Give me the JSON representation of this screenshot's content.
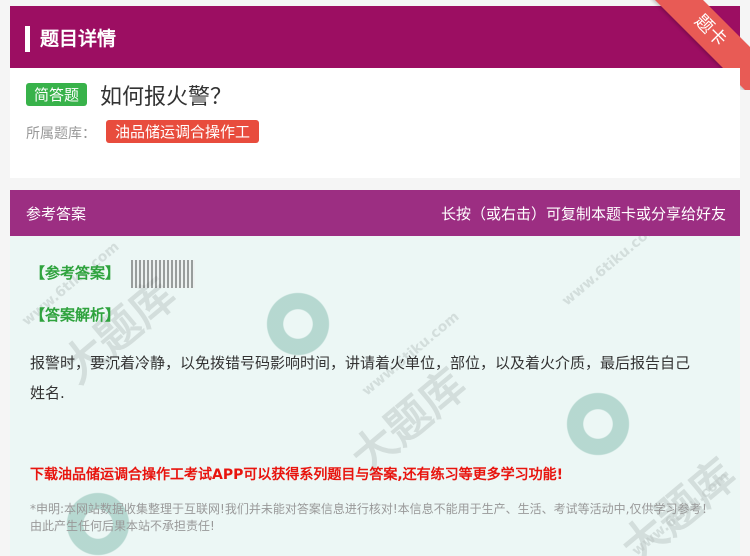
{
  "header": {
    "title": "题目详情",
    "ribbon": "题卡"
  },
  "question": {
    "type_tag": "简答题",
    "text": "如何报火警？",
    "bank_label": "所属题库：",
    "bank_name": "油品储运调合操作工"
  },
  "answer_header": {
    "left": "参考答案",
    "right": "长按（或右击）可复制本题卡或分享给好友"
  },
  "answer": {
    "answer_label": "【参考答案】",
    "parse_label": "【答案解析】",
    "parse_text": "报警时，要沉着冷静，以免拨错号码影响时间，讲请着火单位，部位，以及着火介质，最后报告自己姓名.",
    "download": "下载油品储运调合操作工考试APP可以获得系列题目与答案,还有练习等更多学习功能!",
    "disclaimer": "*申明:本网站数据收集整理于互联网!我们并未能对答案信息进行核对!本信息不能用于生产、生活、考试等活动中,仅供学习参考！由此产生任何后果本站不承担责任!"
  },
  "watermark": {
    "text1": "大题库",
    "text2": "www.6tiku.com"
  }
}
